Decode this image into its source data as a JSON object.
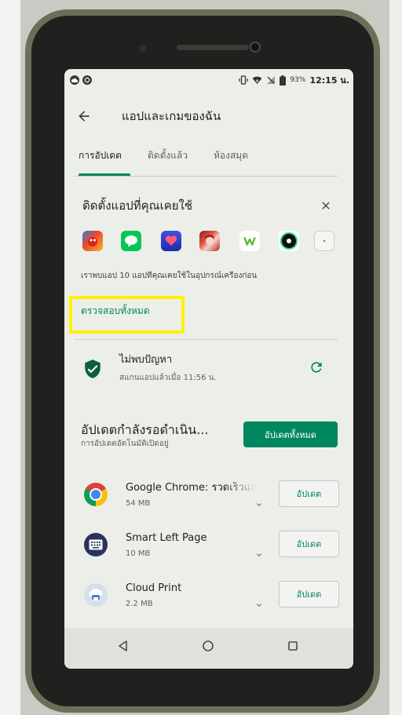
{
  "status_bar": {
    "notification_icons": [
      "cloud-notification-icon",
      "chat-notification-icon"
    ],
    "indicator_icons": [
      "vibrate-icon",
      "wifi-icon",
      "no-signal-icon",
      "battery-icon"
    ],
    "battery_percent": "93%",
    "time": "12:15 น."
  },
  "app_bar": {
    "back_icon": "arrow-back-icon",
    "title": "แอปและเกมของฉัน"
  },
  "tabs": [
    {
      "label": "การอัปเดต",
      "selected": true
    },
    {
      "label": "ติดตั้งแล้ว",
      "selected": false
    },
    {
      "label": "ห้องสมุด",
      "selected": false
    }
  ],
  "restore_card": {
    "title": "ติดตั้งแอปที่คุณเคยใช้",
    "close_icon": "close-icon",
    "app_icons": [
      "game-app-icon",
      "line-app-icon",
      "blue-app-icon",
      "anime-game-app-icon",
      "w-app-icon",
      "ring-app-icon",
      "more-apps-icon"
    ],
    "description": "เราพบแอป 10 แอปที่คุณเคยใช้ในอุปกรณ์เครื่องก่อน",
    "link_label": "ตรวจสอบทั้งหมด"
  },
  "play_protect": {
    "icon": "shield-check-icon",
    "title": "ไม่พบปัญหา",
    "subtitle": "สแกนแอปแล้วเมื่อ 11:56 น.",
    "refresh_icon": "refresh-icon"
  },
  "updates": {
    "title": "อัปเดตกำลังรอดำเนิน...",
    "subtitle": "การอัปเดตอัตโนมัติเปิดอยู่",
    "update_all_label": "อัปเดตทั้งหมด",
    "apps": [
      {
        "icon": "chrome-icon",
        "name": "Google Chrome: รวดเร็วแล",
        "size": "54 MB",
        "button_label": "อัปเดต",
        "expand_icon": "chevron-down-icon"
      },
      {
        "icon": "smart-left-page-icon",
        "name": "Smart Left Page",
        "size": "10 MB",
        "button_label": "อัปเดต",
        "expand_icon": "chevron-down-icon"
      },
      {
        "icon": "cloud-print-icon",
        "name": "Cloud Print",
        "size": "2.2 MB",
        "button_label": "อัปเดต",
        "expand_icon": "chevron-down-icon"
      }
    ]
  },
  "nav_bar": {
    "icons": [
      "nav-back-icon",
      "nav-home-icon",
      "nav-recents-icon"
    ]
  },
  "colors": {
    "accent": "#01875f",
    "highlight": "#fff200",
    "protect_shield": "#0d5e3c"
  }
}
